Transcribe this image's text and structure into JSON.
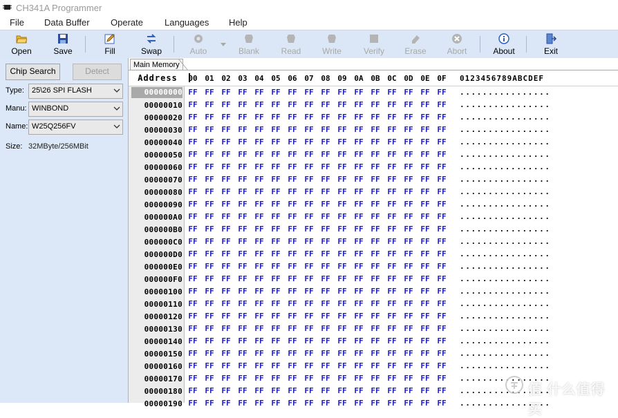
{
  "window": {
    "title": "CH341A Programmer"
  },
  "menu": [
    "File",
    "Data Buffer",
    "Operate",
    "Languages",
    "Help"
  ],
  "toolbar": [
    {
      "label": "Open",
      "icon": "open-folder-icon",
      "enabled": true
    },
    {
      "label": "Save",
      "icon": "save-disk-icon",
      "enabled": true
    },
    {
      "label": "Fill",
      "icon": "fill-pencil-icon",
      "enabled": true
    },
    {
      "label": "Swap",
      "icon": "swap-arrows-icon",
      "enabled": true
    },
    {
      "label": "Auto",
      "icon": "auto-gear-icon",
      "enabled": false
    },
    {
      "label": "Blank",
      "icon": "blank-chip-icon",
      "enabled": false
    },
    {
      "label": "Read",
      "icon": "read-chip-icon",
      "enabled": false
    },
    {
      "label": "Write",
      "icon": "write-chip-icon",
      "enabled": false
    },
    {
      "label": "Verify",
      "icon": "verify-chip-icon",
      "enabled": false
    },
    {
      "label": "Erase",
      "icon": "erase-chip-icon",
      "enabled": false
    },
    {
      "label": "Abort",
      "icon": "abort-x-icon",
      "enabled": false
    },
    {
      "label": "About",
      "icon": "about-info-icon",
      "enabled": true
    },
    {
      "label": "Exit",
      "icon": "exit-door-icon",
      "enabled": true
    }
  ],
  "panel": {
    "chip_search": "Chip Search",
    "detect": "Detect",
    "type_label": "Type:",
    "type_value": "25\\26 SPI FLASH",
    "manu_label": "Manu:",
    "manu_value": "WINBOND",
    "name_label": "Name:",
    "name_value": "W25Q256FV",
    "size_label": "Size:",
    "size_value": "32MByte/256MBit"
  },
  "tab": {
    "label": "Main Memory"
  },
  "hex": {
    "address_header": "Address",
    "columns": [
      "00",
      "01",
      "02",
      "03",
      "04",
      "05",
      "06",
      "07",
      "08",
      "09",
      "0A",
      "0B",
      "0C",
      "0D",
      "0E",
      "0F"
    ],
    "ascii_header": "0123456789ABCDEF",
    "fill_byte": "FF",
    "fill_ascii": "................",
    "addresses": [
      "00000000",
      "00000010",
      "00000020",
      "00000030",
      "00000040",
      "00000050",
      "00000060",
      "00000070",
      "00000080",
      "00000090",
      "000000A0",
      "000000B0",
      "000000C0",
      "000000D0",
      "000000E0",
      "000000F0",
      "00000100",
      "00000110",
      "00000120",
      "00000130",
      "00000140",
      "00000150",
      "00000160",
      "00000170",
      "00000180",
      "00000190"
    ]
  },
  "watermark": {
    "text": "值 什么值得买"
  },
  "colors": {
    "hex_byte": "#2020b4",
    "toolbar_bg": "#dbe7f6",
    "panel_bg": "#dce8f7",
    "selected_address_bg": "#a9a9a9"
  }
}
